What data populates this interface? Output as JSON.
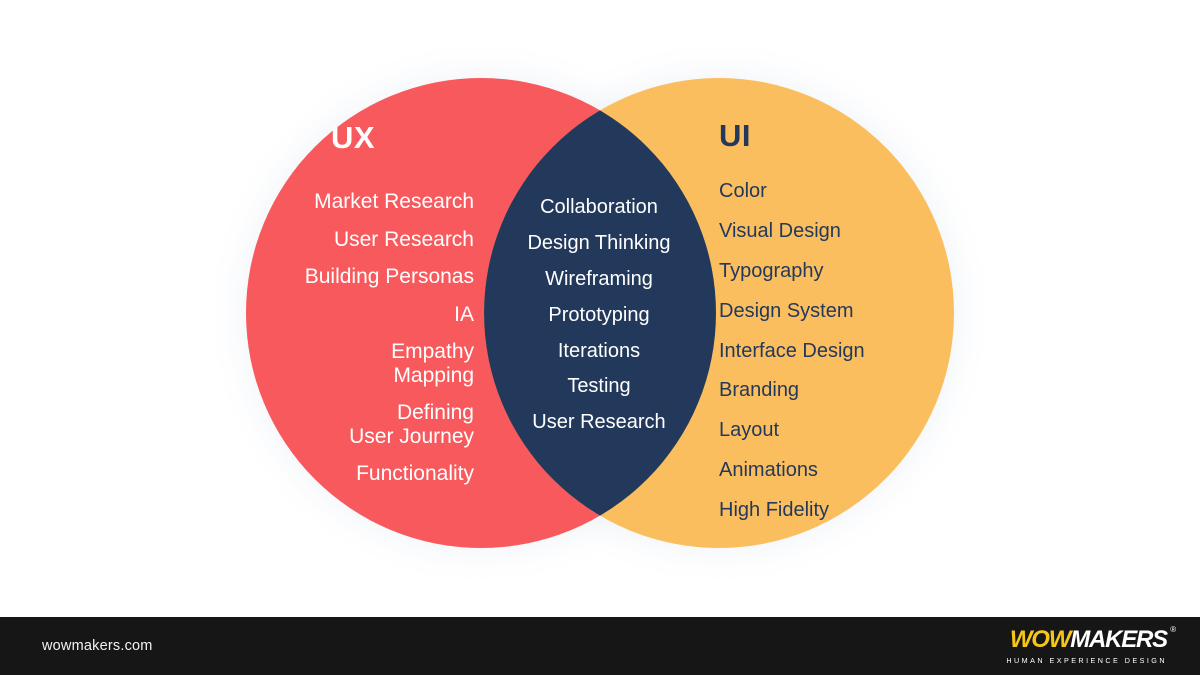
{
  "page": {
    "background_color": "#ffffff",
    "type": "venn-diagram-infographic"
  },
  "diagram": {
    "type": "venn",
    "left_circle": {
      "color": "#f8595c",
      "heading": "UX",
      "heading_color": "#ffffff",
      "items": [
        "Market Research",
        "User Research",
        "Building Personas",
        "IA",
        "Empathy\nMapping",
        "Defining\nUser Journey",
        "Functionality"
      ]
    },
    "right_circle": {
      "color": "#fbbe5e",
      "heading": "UI",
      "heading_color": "#23395b",
      "items": [
        "Color",
        "Visual Design",
        "Typography",
        "Design System",
        "Interface Design",
        "Branding",
        "Layout",
        "Animations",
        "High Fidelity"
      ]
    },
    "intersection": {
      "color": "#23395b",
      "text_color": "#ffffff",
      "items": [
        "Collaboration",
        "Design Thinking",
        "Wireframing",
        "Prototyping",
        "Iterations",
        "Testing",
        "User Research"
      ]
    }
  },
  "footer": {
    "background_color": "#161616",
    "url": "wowmakers.com",
    "logo": {
      "word_primary": "WOW",
      "word_primary_color": "#f5c518",
      "word_secondary": "MAKERS",
      "word_secondary_color": "#ffffff",
      "registered_mark": "®",
      "tagline": "HUMAN EXPERIENCE DESIGN"
    }
  }
}
